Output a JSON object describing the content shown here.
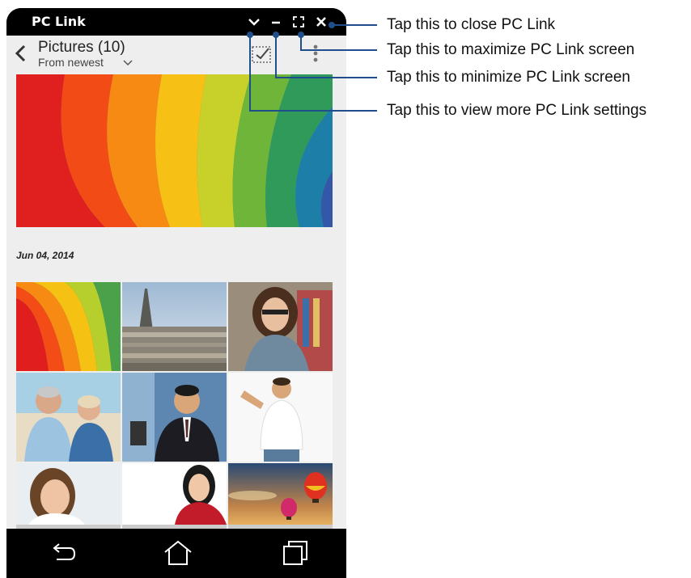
{
  "titlebar": {
    "title": "PC Link",
    "buttons": [
      "chevron-down-icon",
      "minimize-icon",
      "maximize-icon",
      "close-icon"
    ]
  },
  "header": {
    "title": "Pictures (10)",
    "sort_label": "From newest",
    "icons": [
      "back-arrow-icon",
      "select-checkbox-icon",
      "overflow-menu-icon"
    ]
  },
  "gallery": {
    "date_label": "Jun 04, 2014",
    "thumbnails": [
      "rainbow-paper-photo",
      "eiffel-tower-paris-photo",
      "smiling-woman-glasses-photo",
      "senior-couple-beach-photo",
      "businessman-suit-photo",
      "man-white-tshirt-photo",
      "woman-portrait-photo",
      "asian-woman-red-dress-photo",
      "hot-air-balloons-sunset-photo"
    ]
  },
  "navbar": {
    "icons": [
      "back-icon",
      "home-icon",
      "recent-apps-icon"
    ]
  },
  "callouts": {
    "close": "Tap this to close PC Link",
    "maximize": "Tap this to maximize PC Link screen",
    "minimize": "Tap this to minimize PC Link screen",
    "settings": "Tap this to view more PC Link settings"
  },
  "colors": {
    "leader_line": "#1f4e8c",
    "titlebar_bg": "#000000",
    "screen_bg": "#eeeeee"
  }
}
